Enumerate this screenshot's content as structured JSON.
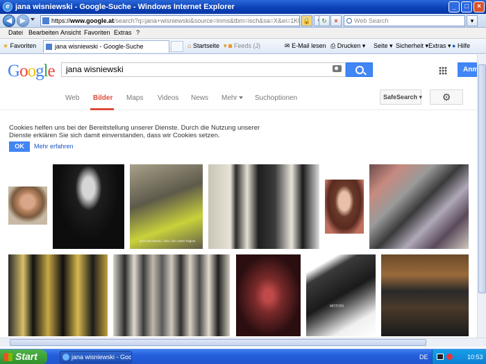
{
  "window": {
    "title": "jana wisniewski - Google-Suche - Windows Internet Explorer"
  },
  "address": {
    "prefix": "https://",
    "domain": "www.google.at",
    "rest": "/search?q=jana+wisniewski&source=lnms&tbm=isch&sa=X&ei=1K0RUSL8HKWBy"
  },
  "websearch": {
    "placeholder": "Web Search"
  },
  "menu": [
    "Datei",
    "Bearbeiten",
    "Ansicht",
    "Favoriten",
    "Extras",
    "?"
  ],
  "favbar": {
    "favorites": "Favoriten",
    "tab_title": "jana wisniewski - Google-Suche",
    "startseite": "Startseite",
    "feeds": "Feeds (J)",
    "email": "E-Mail lesen",
    "drucken": "Drucken",
    "seite": "Seite",
    "sicherheit": "Sicherheit",
    "extras": "Extras",
    "hilfe": "Hilfe"
  },
  "google": {
    "query": "jana wisniewski",
    "signin": "Anmelden",
    "tabs": [
      "Web",
      "Bilder",
      "Maps",
      "Videos",
      "News",
      "Mehr",
      "Suchoptionen"
    ],
    "active_tab": "Bilder",
    "safesearch": "SafeSearch",
    "cookie_text": "Cookies helfen uns bei der Bereitstellung unserer Dienste. Durch die Nutzung unserer Dienste erklären Sie sich damit einverstanden, dass wir Cookies setzen.",
    "ok": "OK",
    "learn_more": "Mehr erfahren",
    "image_caption": "jana wisniewski, colla, foto: peter hagner",
    "image_label": "MOTION"
  },
  "taskbar": {
    "start": "Start",
    "task": "jana wisniewski - Goo...",
    "lang": "DE",
    "time": "10:53"
  },
  "colors": {
    "accent": "#4285f4",
    "active_tab": "#dd4b39",
    "link": "#1a55c8"
  }
}
